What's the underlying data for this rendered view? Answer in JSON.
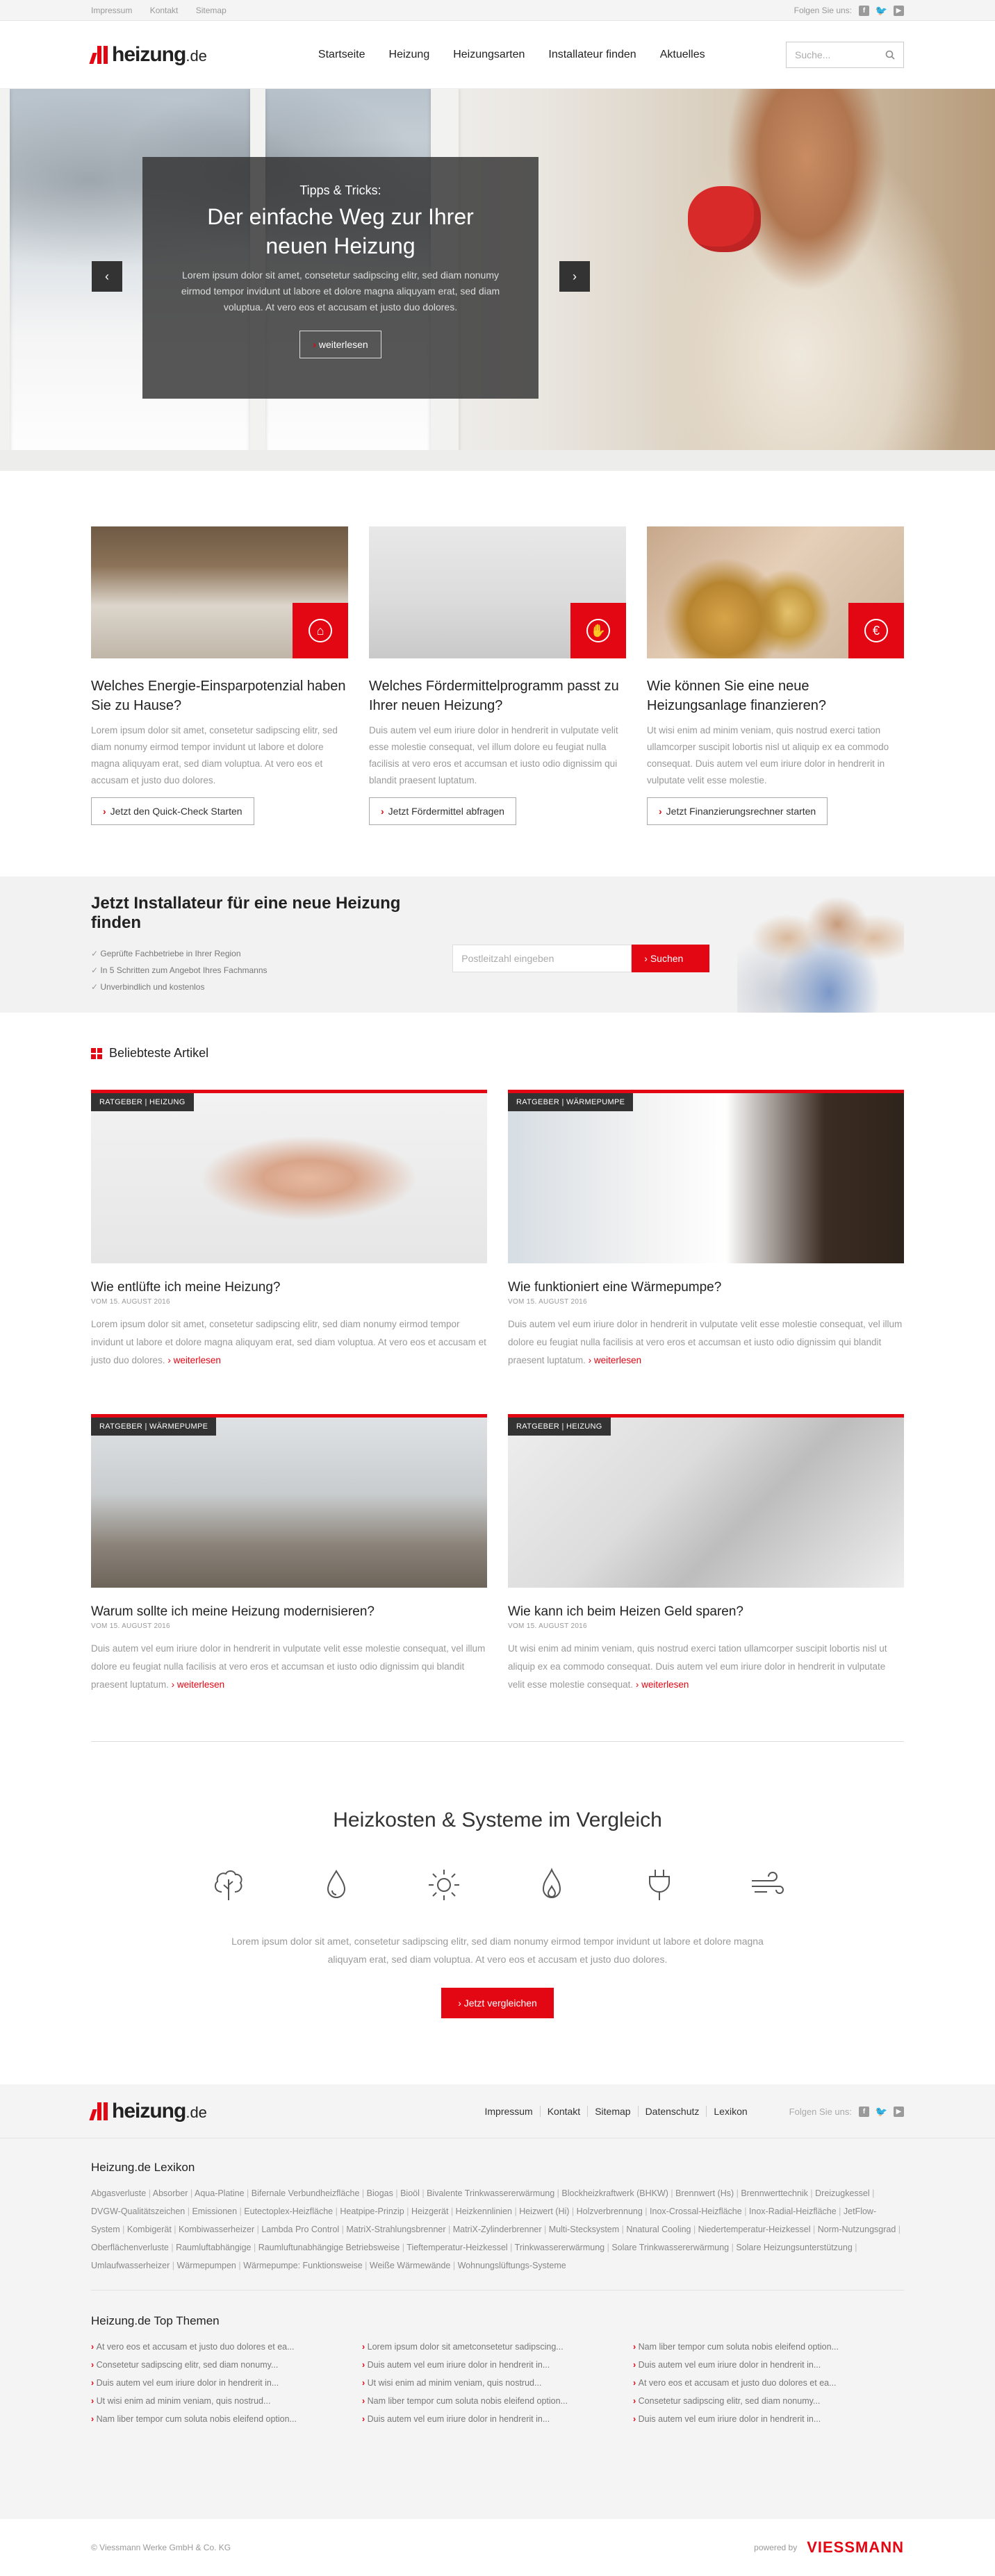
{
  "topbar": {
    "links": [
      "Impressum",
      "Kontakt",
      "Sitemap"
    ],
    "follow": "Folgen Sie uns:"
  },
  "header": {
    "logo": "heizung",
    "logo_tld": ".de",
    "nav": [
      "Startseite",
      "Heizung",
      "Heizungsarten",
      "Installateur finden",
      "Aktuelles"
    ],
    "search_placeholder": "Suche..."
  },
  "hero": {
    "kicker": "Tipps & Tricks:",
    "title": "Der einfache Weg zur Ihrer neuen Heizung",
    "text": "Lorem ipsum dolor sit amet, consetetur sadipscing elitr, sed diam nonumy eirmod tempor invidunt ut labore et dolore magna aliquyam erat, sed diam voluptua. At vero eos et accusam et justo duo dolores.",
    "button": "weiterlesen",
    "prev": "‹",
    "next": "›"
  },
  "teasers": [
    {
      "title": "Welches Energie-Einsparpotenzial haben Sie zu Hause?",
      "text": "Lorem ipsum dolor sit amet, consetetur sadipscing elitr, sed diam nonumy eirmod tempor invidunt ut labore et dolore magna aliquyam erat, sed diam voluptua. At vero eos et accusam et justo duo dolores.",
      "button": "Jetzt den Quick-Check Starten",
      "icon": "⌂"
    },
    {
      "title": "Welches Fördermittelprogramm passt zu Ihrer neuen Heizung?",
      "text": "Duis autem vel eum iriure dolor in hendrerit in vulputate velit esse molestie consequat, vel illum dolore eu feugiat nulla facilisis at vero eros et accumsan et iusto odio dignissim qui blandit praesent luptatum.",
      "button": "Jetzt Fördermittel abfragen",
      "icon": "✋"
    },
    {
      "title": "Wie können Sie eine neue Heizungsanlage finanzieren?",
      "text": "Ut wisi enim ad minim veniam, quis nostrud exerci tation ullamcorper suscipit lobortis nisl ut aliquip ex ea commodo consequat. Duis autem vel eum iriure dolor in hendrerit in vulputate velit esse molestie.",
      "button": "Jetzt Finanzierungsrechner starten",
      "icon": "€"
    }
  ],
  "installer": {
    "title": "Jetzt Installateur für eine neue Heizung finden",
    "bullets": [
      "Geprüfte Fachbetriebe in Ihrer Region",
      "In 5 Schritten zum Angebot Ihres Fachmanns",
      "Unverbindlich und kostenlos"
    ],
    "placeholder": "Postleitzahl eingeben",
    "button": "Suchen"
  },
  "popular": {
    "title": "Beliebteste Artikel",
    "articles": [
      {
        "tag": "RATGEBER | HEIZUNG",
        "title": "Wie entlüfte ich meine Heizung?",
        "date": "VOM 15. AUGUST 2016",
        "text": "Lorem ipsum dolor sit amet, consetetur sadipscing elitr, sed diam nonumy eirmod tempor invidunt ut labore et dolore magna aliquyam erat, sed diam voluptua. At vero eos et accusam et justo duo dolores.",
        "more": "weiterlesen"
      },
      {
        "tag": "RATGEBER | WÄRMEPUMPE",
        "title": "Wie funktioniert eine Wärmepumpe?",
        "date": "VOM 15. AUGUST 2016",
        "text": "Duis autem vel eum iriure dolor in hendrerit in vulputate velit esse molestie consequat, vel illum dolore eu feugiat nulla facilisis at vero eros et accumsan et iusto odio dignissim qui blandit praesent luptatum.",
        "more": "weiterlesen"
      },
      {
        "tag": "RATGEBER | WÄRMEPUMPE",
        "title": "Warum sollte ich meine Heizung modernisieren?",
        "date": "VOM 15. AUGUST 2016",
        "text": "Duis autem vel eum iriure dolor in hendrerit in vulputate velit esse molestie consequat, vel illum dolore eu feugiat nulla facilisis at vero eros et accumsan et iusto odio dignissim qui blandit praesent luptatum.",
        "more": "weiterlesen"
      },
      {
        "tag": "RATGEBER | HEIZUNG",
        "title": "Wie kann ich beim Heizen Geld sparen?",
        "date": "VOM 15. AUGUST 2016",
        "text": "Ut wisi enim ad minim veniam, quis nostrud exerci tation ullamcorper suscipit lobortis nisl ut aliquip ex ea commodo consequat. Duis autem vel eum iriure dolor in hendrerit in vulputate velit esse molestie consequat.",
        "more": "weiterlesen"
      }
    ]
  },
  "compare": {
    "title": "Heizkosten & Systeme im Vergleich",
    "text": "Lorem ipsum dolor sit amet, consetetur sadipscing elitr, sed diam nonumy eirmod tempor invidunt ut labore et dolore magna aliquyam erat, sed diam voluptua. At vero eos et accusam et justo duo dolores.",
    "button": "Jetzt vergleichen",
    "icons": [
      "tree-icon",
      "drop-icon",
      "sun-icon",
      "flame-icon",
      "plug-icon",
      "wind-icon"
    ]
  },
  "footer": {
    "links": [
      "Impressum",
      "Kontakt",
      "Sitemap",
      "Datenschutz",
      "Lexikon"
    ],
    "follow": "Folgen Sie uns:",
    "lexikon_title": "Heizung.de Lexikon",
    "lexikon": [
      "Abgasverluste",
      "Absorber",
      "Aqua-Platine",
      "Bifernale Verbundheizfläche",
      "Biogas",
      "Bioöl",
      "Bivalente Trinkwassererwärmung",
      "Blockheizkraftwerk (BHKW)",
      "Brennwert (Hs)",
      "Brennwerttechnik",
      "Dreizugkessel",
      "DVGW-Qualitätszeichen",
      "Emissionen",
      "Eutectoplex-Heizfläche",
      "Heatpipe-Prinzip",
      "Heizgerät",
      "Heizkennlinien",
      "Heizwert (Hi)",
      "Holzverbrennung",
      "Inox-Crossal-Heizfläche",
      "Inox-Radial-Heizfläche",
      "JetFlow-System",
      "Kombigerät",
      "Kombiwasserheizer",
      "Lambda Pro Control",
      "MatriX-Strahlungsbrenner",
      "MatriX-Zylinderbrenner",
      "Multi-Stecksystem",
      "Nnatural Cooling",
      "Niedertemperatur-Heizkessel",
      "Norm-Nutzungsgrad",
      "Oberflächenverluste",
      "Raumluftabhängige",
      "Raumluftunabhängige Betriebsweise",
      "Tieftemperatur-Heizkessel",
      "Trinkwassererwärmung",
      "Solare Trinkwassererwärmung",
      "Solare Heizungsunterstützung",
      "Umlaufwasserheizer",
      "Wärmepumpen",
      "Wärmepumpe: Funktionsweise",
      "Weiße Wärmewände",
      "Wohnungslüftungs-Systeme"
    ],
    "topics_title": "Heizung.de Top Themen",
    "topics": [
      [
        "At vero eos et accusam et justo duo dolores et ea...",
        "Consetetur sadipscing elitr, sed diam nonumy...",
        "Duis autem vel eum iriure dolor in hendrerit in...",
        "Ut wisi enim ad minim veniam, quis nostrud...",
        "Nam liber tempor cum soluta nobis eleifend option..."
      ],
      [
        "Lorem ipsum dolor sit ametconsetetur sadipscing...",
        "Duis autem vel eum iriure dolor in hendrerit in...",
        "Ut wisi enim ad minim veniam, quis nostrud...",
        "Nam liber tempor cum soluta nobis eleifend option...",
        "Duis autem vel eum iriure dolor in hendrerit in..."
      ],
      [
        "Nam liber tempor cum soluta nobis eleifend option...",
        "Duis autem vel eum iriure dolor in hendrerit in...",
        "At vero eos et accusam et justo duo dolores et ea...",
        "Consetetur sadipscing elitr, sed diam nonumy...",
        "Duis autem vel eum iriure dolor in hendrerit in..."
      ]
    ],
    "copyright": "© Viessmann Werke GmbH & Co. KG",
    "powered": "powered by",
    "brand": "VIESSMANN"
  }
}
